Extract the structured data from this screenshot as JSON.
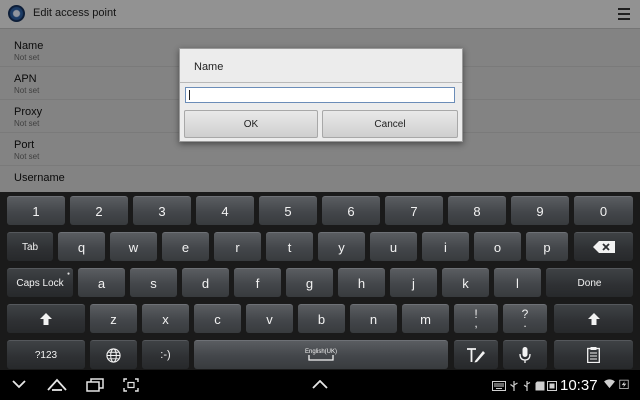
{
  "header": {
    "title": "Edit access point"
  },
  "settings": [
    {
      "label": "Name",
      "value": "Not set"
    },
    {
      "label": "APN",
      "value": "Not set"
    },
    {
      "label": "Proxy",
      "value": "Not set"
    },
    {
      "label": "Port",
      "value": "Not set"
    },
    {
      "label": "Username",
      "value": ""
    }
  ],
  "dialog": {
    "title": "Name",
    "input_value": "",
    "ok_label": "OK",
    "cancel_label": "Cancel"
  },
  "keyboard": {
    "digits": [
      "1",
      "2",
      "3",
      "4",
      "5",
      "6",
      "7",
      "8",
      "9",
      "0"
    ],
    "row_q": [
      "q",
      "w",
      "e",
      "r",
      "t",
      "y",
      "u",
      "i",
      "o",
      "p"
    ],
    "row_a": [
      "a",
      "s",
      "d",
      "f",
      "g",
      "h",
      "j",
      "k",
      "l"
    ],
    "row_z": [
      "z",
      "x",
      "c",
      "v",
      "b",
      "n",
      "m"
    ],
    "tab_label": "Tab",
    "caps_label": "Caps Lock",
    "done_label": "Done",
    "sym_label": "?123",
    "smiley_label": ":-)",
    "space_label": "English(UK)",
    "punct1": {
      "top": "!",
      "bottom": ","
    },
    "punct2": {
      "top": "?",
      "bottom": "."
    }
  },
  "statusbar": {
    "time": "10:37"
  },
  "colors": {
    "accent": "#6b8db8",
    "keyboard_bg": "#1a1a1a"
  }
}
